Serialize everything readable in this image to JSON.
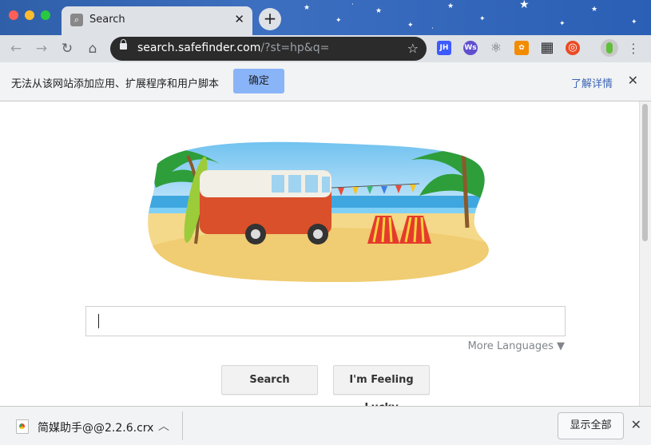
{
  "tab": {
    "title": "Search",
    "favicon": "search-icon"
  },
  "address_bar": {
    "host": "search.safefinder.com",
    "path": "/?st=hp&q="
  },
  "extensions": [
    {
      "name": "jh-extension-icon",
      "label": "JH",
      "color": "#3d5afe"
    },
    {
      "name": "ws-extension-icon",
      "label": "Ws",
      "color": "#5e4fcf"
    },
    {
      "name": "react-extension-icon",
      "label": "⚛",
      "color": "#5f6368"
    },
    {
      "name": "orange-extension-icon",
      "label": "✿",
      "color": "#f28b00"
    },
    {
      "name": "qr-extension-icon",
      "label": "▦",
      "color": "#202124"
    },
    {
      "name": "lifebuoy-extension-icon",
      "label": "◎",
      "color": "#ea4b25"
    }
  ],
  "infobar": {
    "message": "无法从该网站添加应用、扩展程序和用户脚本",
    "confirm_label": "确定",
    "learn_more": "了解详情"
  },
  "search": {
    "more_languages": "More Languages ▼",
    "search_button": "Search",
    "lucky_button": "I'm Feeling Lucky"
  },
  "download": {
    "filename": "简媒助手@@2.2.6.crx",
    "show_all": "显示全部"
  },
  "colors": {
    "accent": "#8ab4f8",
    "title_bar": "#2f5fa8"
  }
}
